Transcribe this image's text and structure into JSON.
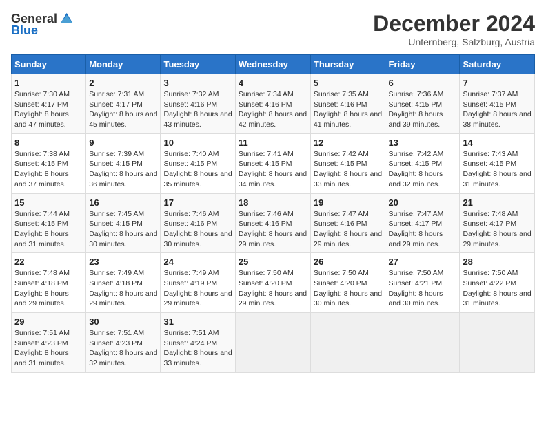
{
  "logo": {
    "general": "General",
    "blue": "Blue"
  },
  "title": "December 2024",
  "subtitle": "Unternberg, Salzburg, Austria",
  "days_header": [
    "Sunday",
    "Monday",
    "Tuesday",
    "Wednesday",
    "Thursday",
    "Friday",
    "Saturday"
  ],
  "weeks": [
    [
      {
        "day": "1",
        "info": "Sunrise: 7:30 AM\nSunset: 4:17 PM\nDaylight: 8 hours and 47 minutes."
      },
      {
        "day": "2",
        "info": "Sunrise: 7:31 AM\nSunset: 4:17 PM\nDaylight: 8 hours and 45 minutes."
      },
      {
        "day": "3",
        "info": "Sunrise: 7:32 AM\nSunset: 4:16 PM\nDaylight: 8 hours and 43 minutes."
      },
      {
        "day": "4",
        "info": "Sunrise: 7:34 AM\nSunset: 4:16 PM\nDaylight: 8 hours and 42 minutes."
      },
      {
        "day": "5",
        "info": "Sunrise: 7:35 AM\nSunset: 4:16 PM\nDaylight: 8 hours and 41 minutes."
      },
      {
        "day": "6",
        "info": "Sunrise: 7:36 AM\nSunset: 4:15 PM\nDaylight: 8 hours and 39 minutes."
      },
      {
        "day": "7",
        "info": "Sunrise: 7:37 AM\nSunset: 4:15 PM\nDaylight: 8 hours and 38 minutes."
      }
    ],
    [
      {
        "day": "8",
        "info": "Sunrise: 7:38 AM\nSunset: 4:15 PM\nDaylight: 8 hours and 37 minutes."
      },
      {
        "day": "9",
        "info": "Sunrise: 7:39 AM\nSunset: 4:15 PM\nDaylight: 8 hours and 36 minutes."
      },
      {
        "day": "10",
        "info": "Sunrise: 7:40 AM\nSunset: 4:15 PM\nDaylight: 8 hours and 35 minutes."
      },
      {
        "day": "11",
        "info": "Sunrise: 7:41 AM\nSunset: 4:15 PM\nDaylight: 8 hours and 34 minutes."
      },
      {
        "day": "12",
        "info": "Sunrise: 7:42 AM\nSunset: 4:15 PM\nDaylight: 8 hours and 33 minutes."
      },
      {
        "day": "13",
        "info": "Sunrise: 7:42 AM\nSunset: 4:15 PM\nDaylight: 8 hours and 32 minutes."
      },
      {
        "day": "14",
        "info": "Sunrise: 7:43 AM\nSunset: 4:15 PM\nDaylight: 8 hours and 31 minutes."
      }
    ],
    [
      {
        "day": "15",
        "info": "Sunrise: 7:44 AM\nSunset: 4:15 PM\nDaylight: 8 hours and 31 minutes."
      },
      {
        "day": "16",
        "info": "Sunrise: 7:45 AM\nSunset: 4:15 PM\nDaylight: 8 hours and 30 minutes."
      },
      {
        "day": "17",
        "info": "Sunrise: 7:46 AM\nSunset: 4:16 PM\nDaylight: 8 hours and 30 minutes."
      },
      {
        "day": "18",
        "info": "Sunrise: 7:46 AM\nSunset: 4:16 PM\nDaylight: 8 hours and 29 minutes."
      },
      {
        "day": "19",
        "info": "Sunrise: 7:47 AM\nSunset: 4:16 PM\nDaylight: 8 hours and 29 minutes."
      },
      {
        "day": "20",
        "info": "Sunrise: 7:47 AM\nSunset: 4:17 PM\nDaylight: 8 hours and 29 minutes."
      },
      {
        "day": "21",
        "info": "Sunrise: 7:48 AM\nSunset: 4:17 PM\nDaylight: 8 hours and 29 minutes."
      }
    ],
    [
      {
        "day": "22",
        "info": "Sunrise: 7:48 AM\nSunset: 4:18 PM\nDaylight: 8 hours and 29 minutes."
      },
      {
        "day": "23",
        "info": "Sunrise: 7:49 AM\nSunset: 4:18 PM\nDaylight: 8 hours and 29 minutes."
      },
      {
        "day": "24",
        "info": "Sunrise: 7:49 AM\nSunset: 4:19 PM\nDaylight: 8 hours and 29 minutes."
      },
      {
        "day": "25",
        "info": "Sunrise: 7:50 AM\nSunset: 4:20 PM\nDaylight: 8 hours and 29 minutes."
      },
      {
        "day": "26",
        "info": "Sunrise: 7:50 AM\nSunset: 4:20 PM\nDaylight: 8 hours and 30 minutes."
      },
      {
        "day": "27",
        "info": "Sunrise: 7:50 AM\nSunset: 4:21 PM\nDaylight: 8 hours and 30 minutes."
      },
      {
        "day": "28",
        "info": "Sunrise: 7:50 AM\nSunset: 4:22 PM\nDaylight: 8 hours and 31 minutes."
      }
    ],
    [
      {
        "day": "29",
        "info": "Sunrise: 7:51 AM\nSunset: 4:23 PM\nDaylight: 8 hours and 31 minutes."
      },
      {
        "day": "30",
        "info": "Sunrise: 7:51 AM\nSunset: 4:23 PM\nDaylight: 8 hours and 32 minutes."
      },
      {
        "day": "31",
        "info": "Sunrise: 7:51 AM\nSunset: 4:24 PM\nDaylight: 8 hours and 33 minutes."
      },
      {
        "day": "",
        "info": ""
      },
      {
        "day": "",
        "info": ""
      },
      {
        "day": "",
        "info": ""
      },
      {
        "day": "",
        "info": ""
      }
    ]
  ]
}
